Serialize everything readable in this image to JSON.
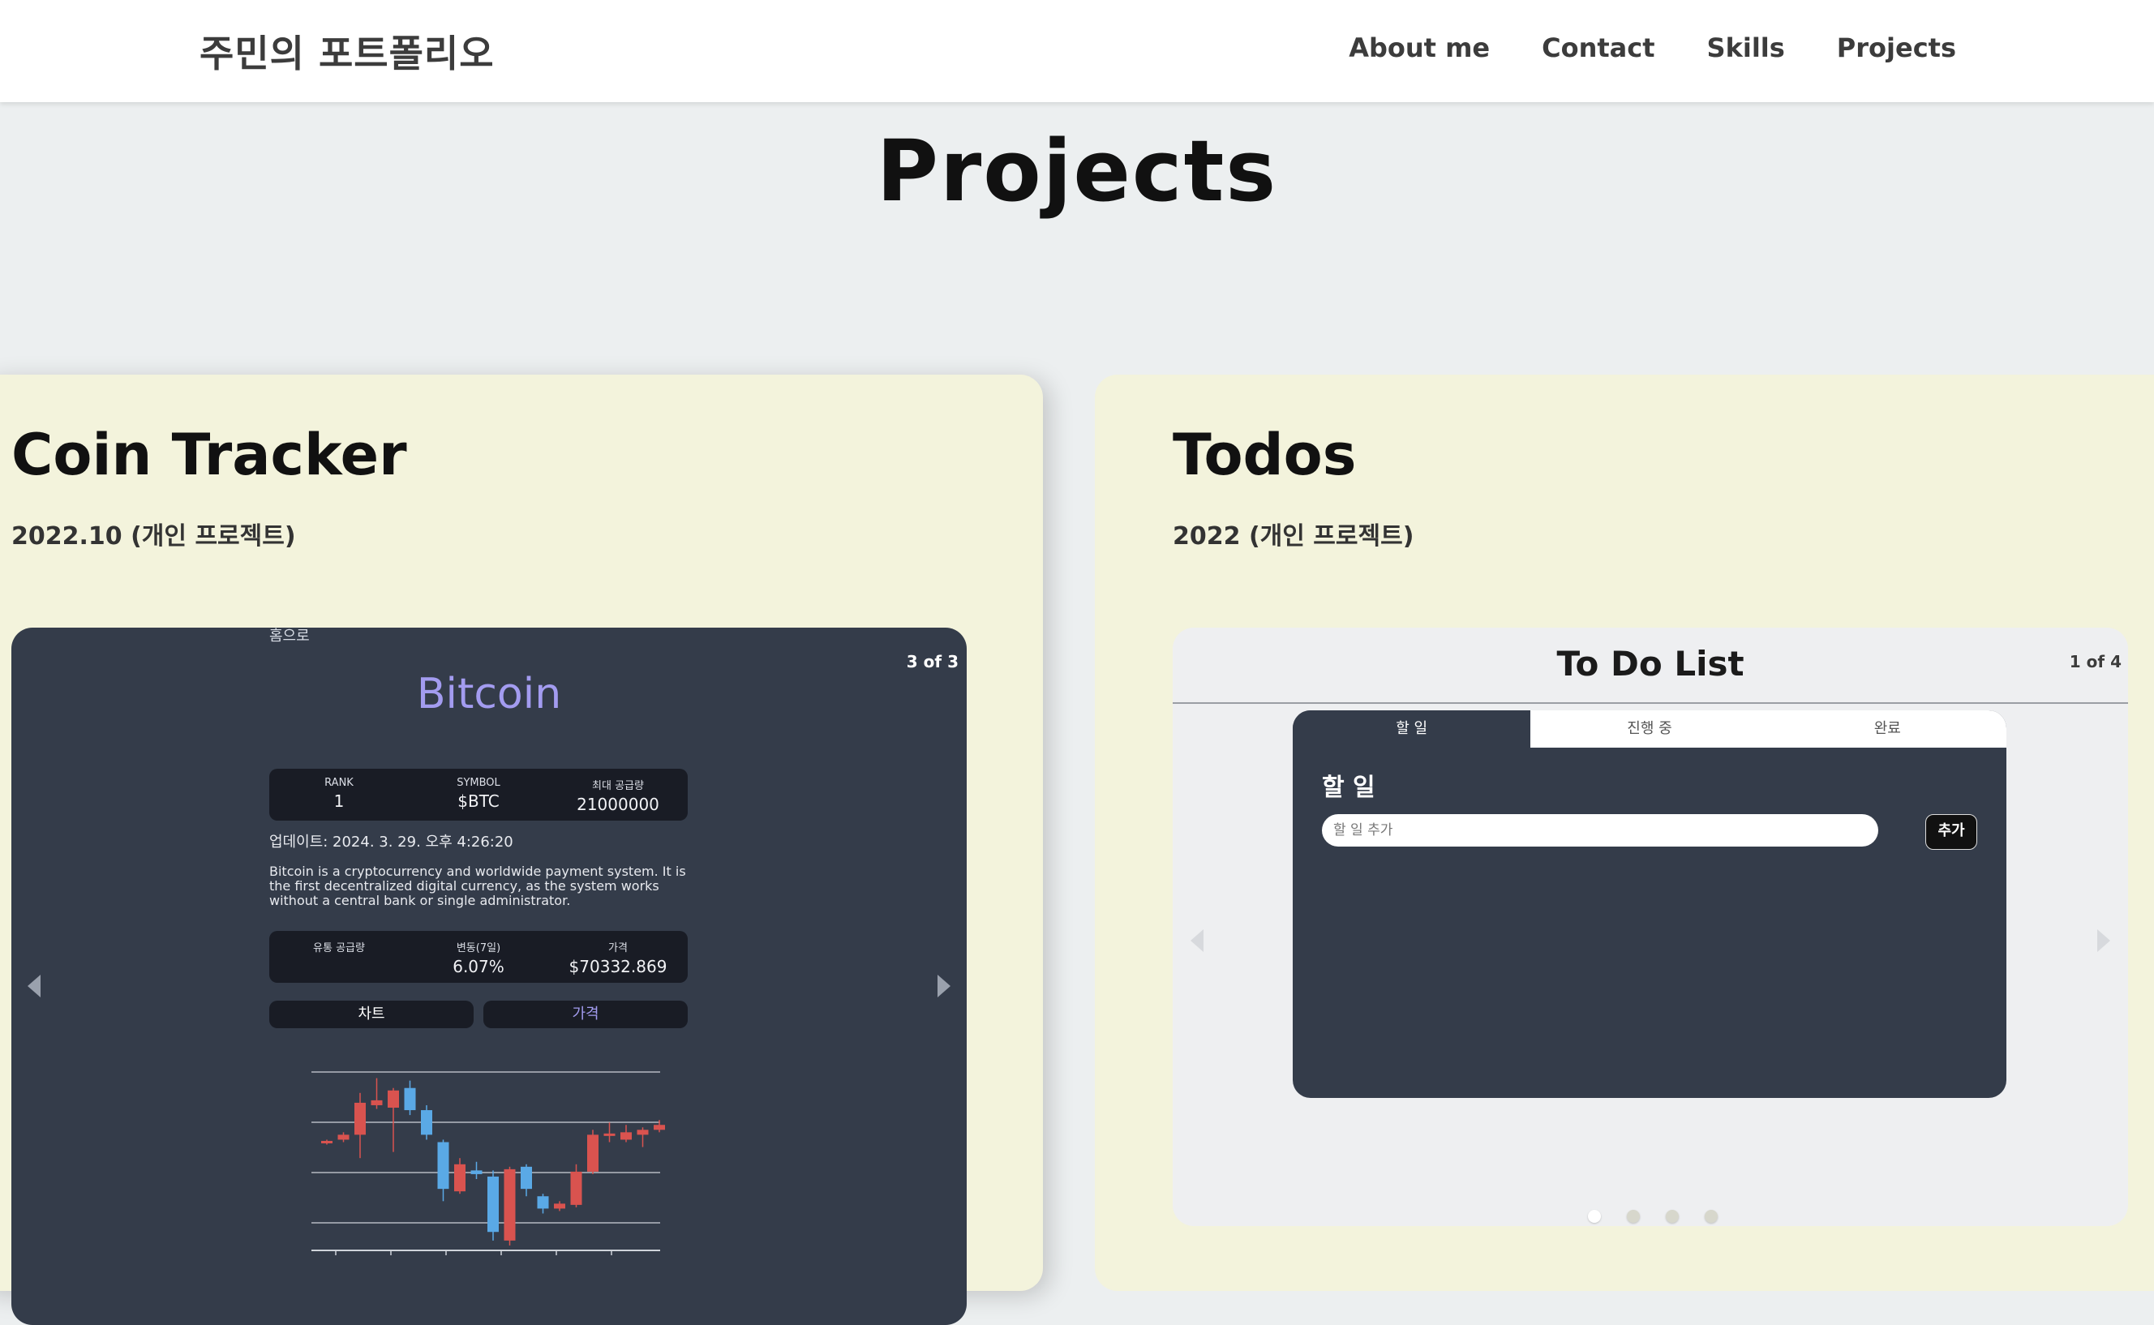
{
  "nav": {
    "brand": "주민의 포트폴리오",
    "links": [
      "About me",
      "Contact",
      "Skills",
      "Projects"
    ]
  },
  "section_title": "Projects",
  "projects": [
    {
      "title": "Coin Tracker",
      "subtitle": "2022.10 (개인 프로젝트)",
      "counter": "3 of 3",
      "home_link": "홈으로",
      "coin": {
        "name": "Bitcoin",
        "stats_top": [
          {
            "label": "RANK",
            "value": "1"
          },
          {
            "label": "SYMBOL",
            "value": "$BTC"
          },
          {
            "label": "최대 공급량",
            "value": "21000000"
          }
        ],
        "updated": "업데이트: 2024. 3. 29. 오후 4:26:20",
        "description": "Bitcoin is a cryptocurrency and worldwide payment system. It is the first decentralized digital currency, as the system works without a central bank or single administrator.",
        "stats_bottom": [
          {
            "label": "유통 공급량",
            "value": ""
          },
          {
            "label": "변동(7일)",
            "value": "6.07%"
          },
          {
            "label": "가격",
            "value": "$70332.869"
          }
        ],
        "tabs": [
          "차트",
          "가격"
        ],
        "active_tab": "가격",
        "colors": {
          "accent": "#a39cf0",
          "up": "#d9534f",
          "down": "#5aa9e6"
        }
      },
      "chart_data": {
        "type": "candlestick",
        "candles": [
          {
            "o": 0.18,
            "h": 0.2,
            "l": 0.16,
            "c": 0.19
          },
          {
            "o": 0.2,
            "h": 0.26,
            "l": 0.18,
            "c": 0.24
          },
          {
            "o": 0.24,
            "h": 0.58,
            "l": 0.05,
            "c": 0.5
          },
          {
            "o": 0.48,
            "h": 0.7,
            "l": 0.45,
            "c": 0.52
          },
          {
            "o": 0.46,
            "h": 0.62,
            "l": 0.1,
            "c": 0.6
          },
          {
            "o": 0.62,
            "h": 0.68,
            "l": 0.4,
            "c": 0.44
          },
          {
            "o": 0.44,
            "h": 0.48,
            "l": 0.2,
            "c": 0.24
          },
          {
            "o": 0.18,
            "h": 0.2,
            "l": -0.3,
            "c": -0.2
          },
          {
            "o": -0.22,
            "h": 0.05,
            "l": -0.24,
            "c": 0.0
          },
          {
            "o": -0.05,
            "h": 0.02,
            "l": -0.12,
            "c": -0.08
          },
          {
            "o": -0.1,
            "h": -0.05,
            "l": -0.62,
            "c": -0.55
          },
          {
            "o": -0.62,
            "h": -0.02,
            "l": -0.66,
            "c": -0.04
          },
          {
            "o": -0.02,
            "h": 0.0,
            "l": -0.26,
            "c": -0.2
          },
          {
            "o": -0.26,
            "h": -0.24,
            "l": -0.4,
            "c": -0.36
          },
          {
            "o": -0.36,
            "h": -0.3,
            "l": -0.38,
            "c": -0.32
          },
          {
            "o": -0.33,
            "h": 0.0,
            "l": -0.35,
            "c": -0.06
          },
          {
            "o": -0.06,
            "h": 0.28,
            "l": -0.08,
            "c": 0.24
          },
          {
            "o": 0.24,
            "h": 0.34,
            "l": 0.18,
            "c": 0.25
          },
          {
            "o": 0.2,
            "h": 0.32,
            "l": 0.18,
            "c": 0.26
          },
          {
            "o": 0.24,
            "h": 0.3,
            "l": 0.14,
            "c": 0.28
          },
          {
            "o": 0.28,
            "h": 0.36,
            "l": 0.26,
            "c": 0.32
          }
        ]
      }
    },
    {
      "title": "Todos",
      "subtitle": "2022 (개인 프로젝트)",
      "counter": "1 of 4",
      "todo": {
        "heading": "To Do List",
        "tabs": [
          "할 일",
          "진행 중",
          "완료"
        ],
        "active_tab": "할 일",
        "section_title": "할 일",
        "input_placeholder": "할 일 추가",
        "add_button": "추가"
      },
      "dots": 4,
      "active_dot": 1
    }
  ],
  "colors": {
    "card_bg": "#f3f3dc",
    "page_bg": "#eceff0",
    "dark_panel": "#343c4a"
  }
}
